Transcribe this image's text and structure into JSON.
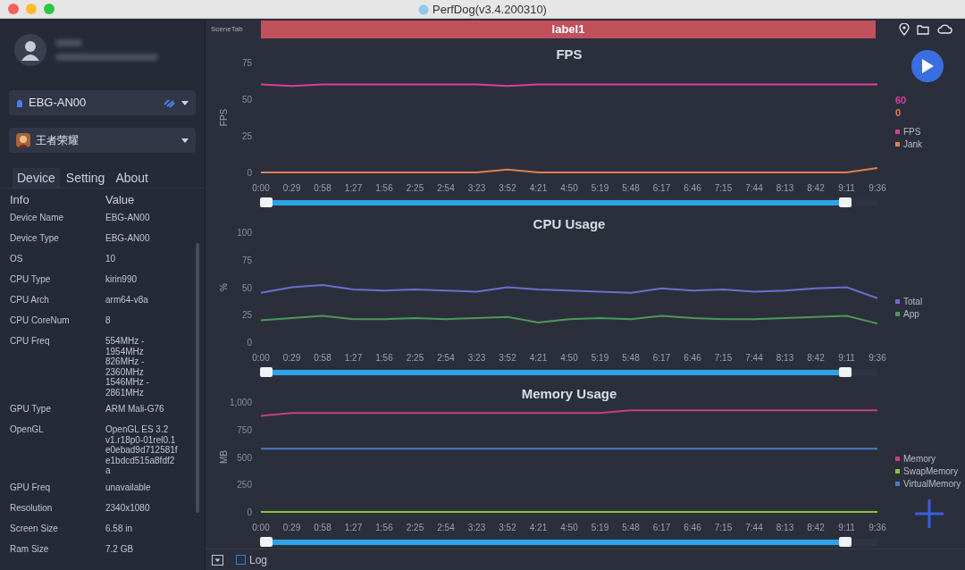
{
  "window": {
    "title": "PerfDog(v3.4.200310)"
  },
  "sidebar": {
    "device": "EBG-AN00",
    "app": "王者荣耀",
    "tabs": [
      {
        "label": "Device",
        "selected": true
      },
      {
        "label": "Setting",
        "selected": false
      },
      {
        "label": "About",
        "selected": false
      }
    ],
    "columns": [
      "Info",
      "Value"
    ],
    "rows": [
      {
        "info": "Device Name",
        "value": "EBG-AN00"
      },
      {
        "info": "Device Type",
        "value": "EBG-AN00"
      },
      {
        "info": "OS",
        "value": "10"
      },
      {
        "info": "CPU Type",
        "value": "kirin990"
      },
      {
        "info": "CPU Arch",
        "value": "arm64-v8a"
      },
      {
        "info": "CPU CoreNum",
        "value": "8"
      },
      {
        "info": "CPU Freq",
        "value": "554MHz -\n1954MHz\n826MHz -\n2360MHz\n1546MHz -\n2861MHz"
      },
      {
        "info": "GPU Type",
        "value": "ARM Mali-G76"
      },
      {
        "info": "OpenGL",
        "value": "OpenGL ES 3.2\nv1.r18p0-01rel0.1\ne0ebad9d712581f\ne1bdcd515a8fdf2\na"
      },
      {
        "info": "GPU Freq",
        "value": "unavailable"
      },
      {
        "info": "Resolution",
        "value": "2340x1080"
      },
      {
        "info": "Screen Size",
        "value": "6.58 in"
      },
      {
        "info": "Ram Size",
        "value": "7.2 GB"
      }
    ]
  },
  "scene_tab": {
    "label": "SceneTab",
    "marker": "label1"
  },
  "charts": [
    {
      "readouts": [
        {
          "text": "60",
          "color": "#d9409a"
        },
        {
          "text": "0",
          "color": "#e0804a"
        }
      ],
      "slider": {
        "level": 1
      },
      "chart_data": {
        "type": "line",
        "title": "FPS",
        "ylabel": "FPS",
        "categories": [
          "0:00",
          "0:29",
          "0:58",
          "1:27",
          "1:56",
          "2:25",
          "2:54",
          "3:23",
          "3:52",
          "4:21",
          "4:50",
          "5:19",
          "5:48",
          "6:17",
          "6:46",
          "7:15",
          "7:44",
          "8:13",
          "8:42",
          "9:11",
          "9:36"
        ],
        "ylim": [
          0,
          75
        ],
        "yticks": [
          0,
          25,
          50,
          75
        ],
        "series": [
          {
            "name": "FPS",
            "color": "#d9409a",
            "values": [
              60,
              59,
              60,
              60,
              60,
              60,
              60,
              60,
              59,
              60,
              60,
              60,
              60,
              60,
              60,
              60,
              60,
              60,
              60,
              60,
              60
            ]
          },
          {
            "name": "Jank",
            "color": "#e0804a",
            "values": [
              0,
              0,
              0,
              0,
              0,
              0,
              0,
              0,
              2,
              0,
              0,
              0,
              0,
              0,
              0,
              0,
              0,
              0,
              0,
              0,
              3
            ]
          }
        ]
      }
    },
    {
      "slider": {
        "level": 1
      },
      "chart_data": {
        "type": "line",
        "title": "CPU Usage",
        "ylabel": "%",
        "categories": [
          "0:00",
          "0:29",
          "0:58",
          "1:27",
          "1:56",
          "2:25",
          "2:54",
          "3:23",
          "3:52",
          "4:21",
          "4:50",
          "5:19",
          "5:48",
          "6:17",
          "6:46",
          "7:15",
          "7:44",
          "8:13",
          "8:42",
          "9:11",
          "9:36"
        ],
        "ylim": [
          0,
          100
        ],
        "yticks": [
          0,
          25,
          50,
          75,
          100
        ],
        "series": [
          {
            "name": "Total",
            "color": "#6a6fd0",
            "values": [
              45,
              50,
              52,
              48,
              47,
              48,
              47,
              46,
              50,
              48,
              47,
              46,
              45,
              49,
              47,
              48,
              46,
              47,
              49,
              50,
              40
            ]
          },
          {
            "name": "App",
            "color": "#4a9a5a",
            "values": [
              20,
              22,
              24,
              21,
              21,
              22,
              21,
              22,
              23,
              18,
              21,
              22,
              21,
              24,
              22,
              21,
              21,
              22,
              23,
              24,
              17
            ]
          }
        ]
      }
    },
    {
      "slider": {
        "level": 1
      },
      "chart_data": {
        "type": "line",
        "title": "Memory Usage",
        "ylabel": "MB",
        "categories": [
          "0:00",
          "0:29",
          "0:58",
          "1:27",
          "1:56",
          "2:25",
          "2:54",
          "3:23",
          "3:52",
          "4:21",
          "4:50",
          "5:19",
          "5:48",
          "6:17",
          "6:46",
          "7:15",
          "7:44",
          "8:13",
          "8:42",
          "9:11",
          "9:36"
        ],
        "ylim": [
          0,
          1000
        ],
        "yticks": [
          0,
          {
            "value": 250,
            "label": "250"
          },
          {
            "value": 500,
            "label": "500"
          },
          {
            "value": 750,
            "label": "750"
          },
          {
            "value": 1000,
            "label": "1,000"
          }
        ],
        "series": [
          {
            "name": "Memory",
            "color": "#c8407a",
            "values": [
              875,
              900,
              900,
              900,
              900,
              900,
              900,
              900,
              900,
              900,
              900,
              900,
              925,
              925,
              925,
              925,
              925,
              925,
              925,
              925,
              925
            ]
          },
          {
            "name": "SwapMemory",
            "color": "#8ac43a",
            "values": [
              0,
              0,
              0,
              0,
              0,
              0,
              0,
              0,
              0,
              0,
              0,
              0,
              0,
              0,
              0,
              0,
              0,
              0,
              0,
              0,
              0
            ]
          },
          {
            "name": "VirtualMemory",
            "color": "#4a7ac8",
            "values": [
              575,
              575,
              575,
              575,
              575,
              575,
              575,
              575,
              575,
              575,
              575,
              575,
              575,
              575,
              575,
              575,
              575,
              575,
              575,
              575,
              575
            ]
          }
        ]
      }
    }
  ],
  "footer": {
    "log_label": "Log",
    "log_checked": false
  }
}
